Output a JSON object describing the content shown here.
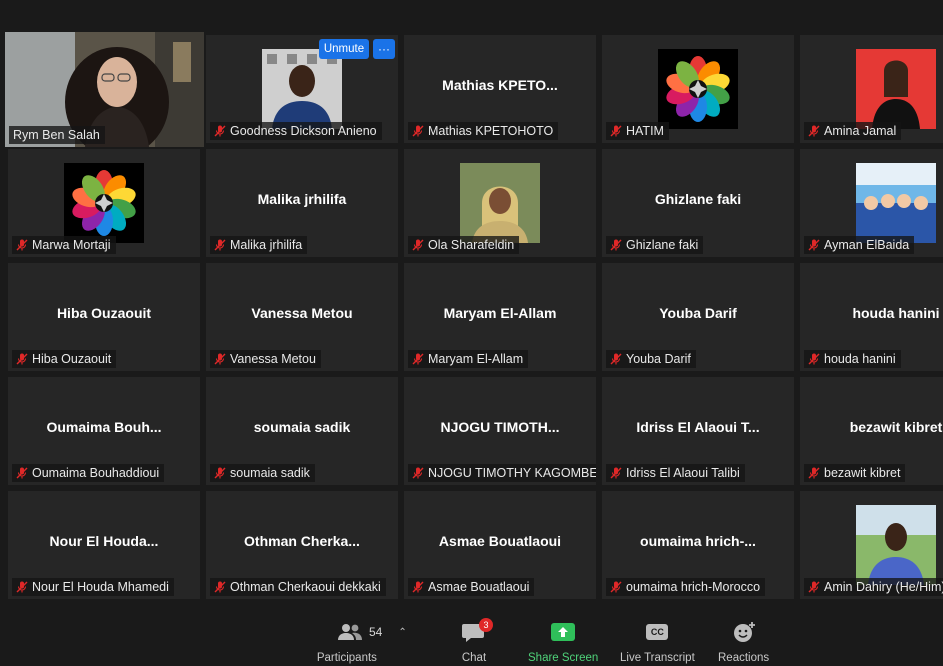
{
  "participants": [
    {
      "label": "Rym Ben Salah",
      "big": "",
      "kind": "video-self"
    },
    {
      "label": "Goodness Dickson Anieno",
      "big": "",
      "kind": "photo-man"
    },
    {
      "label": "Mathias KPETOHOTO",
      "big": "Mathias  KPETO...",
      "kind": "name"
    },
    {
      "label": "HATIM",
      "big": "",
      "kind": "logo"
    },
    {
      "label": "Amina Jamal",
      "big": "",
      "kind": "photo-woman"
    },
    {
      "label": "Marwa Mortaji",
      "big": "",
      "kind": "logo"
    },
    {
      "label": "Malika jrhilifa",
      "big": "Malika jrhilifa",
      "kind": "name"
    },
    {
      "label": "Ola Sharafeldin",
      "big": "",
      "kind": "photo-hijab"
    },
    {
      "label": "Ghizlane faki",
      "big": "Ghizlane faki",
      "kind": "name"
    },
    {
      "label": "Ayman ElBaida",
      "big": "",
      "kind": "photo-anime"
    },
    {
      "label": "Hiba Ouzaouit",
      "big": "Hiba Ouzaouit",
      "kind": "name"
    },
    {
      "label": "Vanessa Metou",
      "big": "Vanessa Metou",
      "kind": "name"
    },
    {
      "label": "Maryam El-Allam",
      "big": "Maryam El-Allam",
      "kind": "name"
    },
    {
      "label": "Youba Darif",
      "big": "Youba Darif",
      "kind": "name"
    },
    {
      "label": "houda hanini",
      "big": "houda hanini",
      "kind": "name"
    },
    {
      "label": "Oumaima Bouhaddioui",
      "big": "Oumaima  Bouh...",
      "kind": "name"
    },
    {
      "label": "soumaia sadik",
      "big": "soumaia sadik",
      "kind": "name"
    },
    {
      "label": "NJOGU TIMOTHY KAGOMBE",
      "big": "NJOGU  TIMOTH...",
      "kind": "name"
    },
    {
      "label": "Idriss El Alaoui Talibi",
      "big": "Idriss El Alaoui T...",
      "kind": "name"
    },
    {
      "label": "bezawit kibret",
      "big": "bezawit kibret",
      "kind": "name"
    },
    {
      "label": "Nour El Houda Mhamedi",
      "big": "Nour  El  Houda...",
      "kind": "name"
    },
    {
      "label": "Othman Cherkaoui dekkaki",
      "big": "Othman  Cherka...",
      "kind": "name"
    },
    {
      "label": "Asmae Bouatlaoui",
      "big": "Asmae Bouatlaoui",
      "kind": "name"
    },
    {
      "label": "oumaima hrich-Morocco",
      "big": "oumaima  hrich-...",
      "kind": "name"
    },
    {
      "label": "Amin Dahiry (He/Him)",
      "big": "",
      "kind": "photo-outdoor"
    }
  ],
  "hover_controls": {
    "unmute": "Unmute",
    "more": "···"
  },
  "toolbar": {
    "participants_label": "Participants",
    "participants_count": "54",
    "chat_label": "Chat",
    "chat_badge": "3",
    "share_label": "Share Screen",
    "transcript_label": "Live Transcript",
    "transcript_icon_text": "CC",
    "reactions_label": "Reactions"
  },
  "colors": {
    "active_speaker": "#e7e98a",
    "unmute_blue": "#1a73e8",
    "share_green": "#4fd37a",
    "mute_red": "#e02828"
  }
}
